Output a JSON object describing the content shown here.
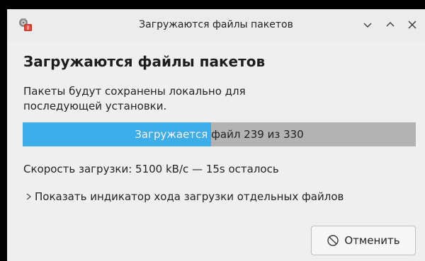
{
  "window": {
    "title": "Загружаются файлы пакетов",
    "app_icon": "package-manager-icon",
    "controls": [
      {
        "name": "minimize-icon",
        "glyph": "chevron-down"
      },
      {
        "name": "maximize-icon",
        "glyph": "chevron-up"
      },
      {
        "name": "close-icon",
        "glyph": "cross"
      }
    ]
  },
  "dialog": {
    "heading": "Загружаются файлы пакетов",
    "description": "Пакеты будут сохранены локально для последующей установки.",
    "progress": {
      "label": "Загружается файл 239 из 330",
      "fraction": 0.48,
      "fill_color": "#3daee9",
      "track_color": "#b3b3b3"
    },
    "speed_text": "Скорость загрузки: 5100 kB/с — 15s осталось",
    "details_toggle": "Показать индикатор хода загрузки отдельных файлов",
    "cancel_button": {
      "label": "Отменить",
      "icon": "cancel-icon"
    }
  }
}
